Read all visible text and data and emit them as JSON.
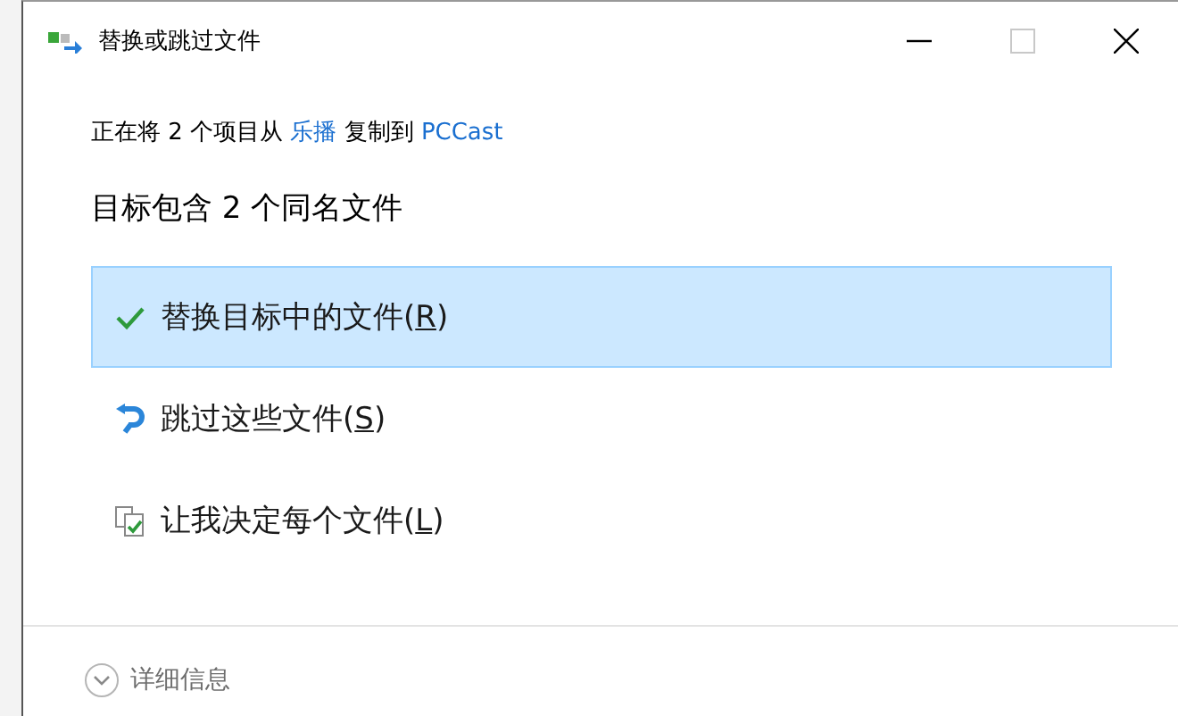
{
  "window": {
    "title": "替换或跳过文件"
  },
  "message": [
    {
      "kind": "text",
      "text": "正在将 2 个项目从 "
    },
    {
      "kind": "link",
      "text": "乐播"
    },
    {
      "kind": "text",
      "text": " 复制到 "
    },
    {
      "kind": "link",
      "text": "PCCast"
    }
  ],
  "heading": "目标包含 2 个同名文件",
  "options": [
    {
      "kind": "replace",
      "label": "替换目标中的文件(R)",
      "selected": true
    },
    {
      "kind": "skip",
      "label": "跳过这些文件(S)",
      "selected": false
    },
    {
      "kind": "decide",
      "label": "让我决定每个文件(L)",
      "selected": false
    }
  ],
  "details": {
    "label": "详细信息",
    "expanded": false
  }
}
